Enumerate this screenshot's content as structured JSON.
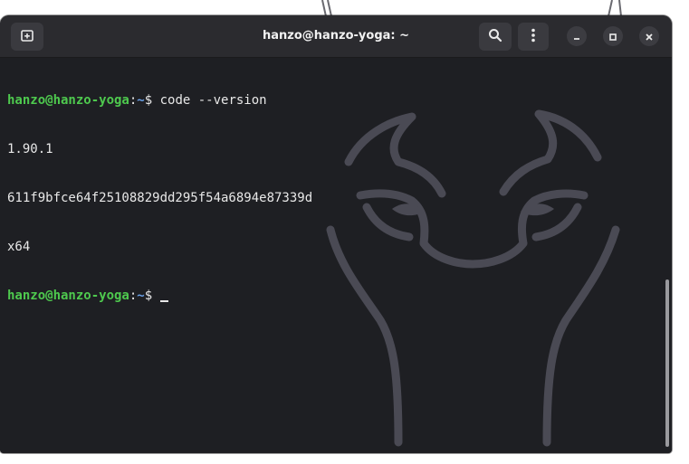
{
  "window": {
    "title": "hanzo@hanzo-yoga: ~"
  },
  "headerbar": {
    "new_tab_icon": "new-tab-icon",
    "search_icon": "search-icon",
    "menu_icon": "kebab-menu-icon",
    "minimize_icon": "minimize-icon",
    "maximize_icon": "maximize-icon",
    "close_icon": "close-icon"
  },
  "terminal": {
    "prompt1": {
      "user_host": "hanzo@hanzo-yoga",
      "sep": ":",
      "path": "~",
      "symbol": "$ ",
      "command": "code --version"
    },
    "output": [
      "1.90.1",
      "611f9bfce64f25108829dd295f54a6894e87339d",
      "x64"
    ],
    "prompt2": {
      "user_host": "hanzo@hanzo-yoga",
      "sep": ":",
      "path": "~",
      "symbol": "$ "
    }
  },
  "colors": {
    "prompt_user": "#4ec94e",
    "prompt_path": "#6aa0e8",
    "terminal_bg": "#1e1f23",
    "headerbar_bg": "#2b2b2f"
  }
}
